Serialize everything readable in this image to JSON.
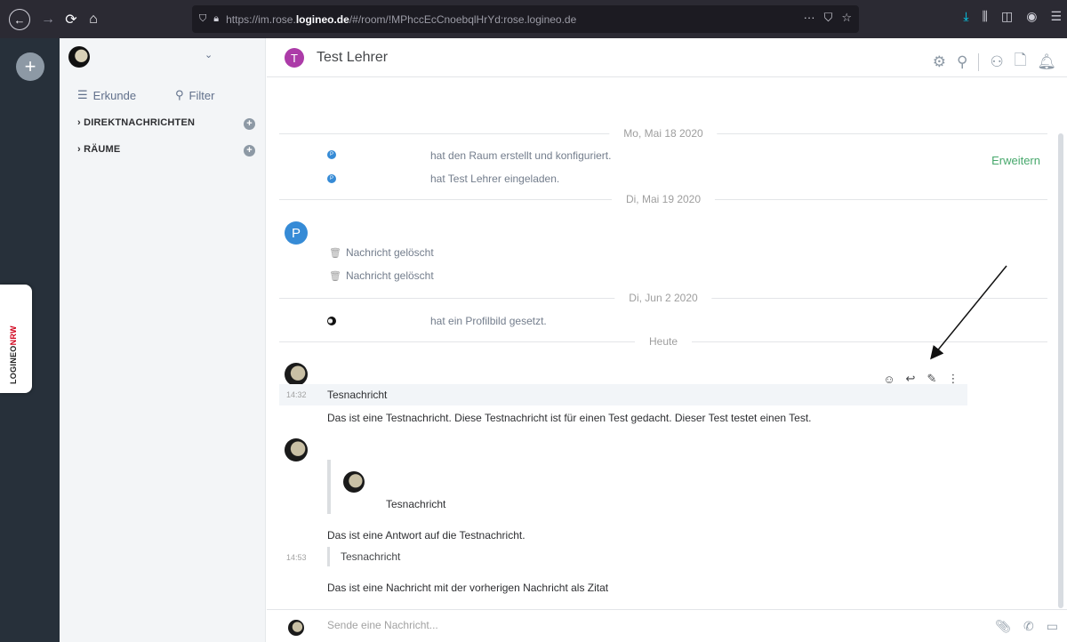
{
  "browser": {
    "url_prefix": "https://im.rose.",
    "url_domain": "logineo.de",
    "url_suffix": "/#/room/!MPhccEcCnoebqlHrYd:rose.logineo.de",
    "icons": [
      "back-icon",
      "forward-icon",
      "reload-icon",
      "home-icon",
      "shield-icon",
      "lock-icon",
      "more-icon",
      "pocket-icon",
      "bookmark-star-icon",
      "download-icon",
      "library-icon",
      "sidebar-icon",
      "account-icon",
      "menu-icon"
    ]
  },
  "logineo": {
    "prefix": "LOGINEO",
    "suffix": "NRW"
  },
  "sidebar": {
    "explore_label": "Erkunde",
    "filter_label": "Filter",
    "sections": [
      {
        "label": "DIREKTNACHRICHTEN"
      },
      {
        "label": "RÄUME"
      }
    ]
  },
  "room": {
    "avatar_letter": "T",
    "title": "Test Lehrer"
  },
  "timeline": {
    "dates": [
      "Mo, Mai 18 2020",
      "Di, Mai 19 2020",
      "Di, Jun 2 2020",
      "Heute"
    ],
    "events": [
      {
        "avatar": "P",
        "text": "hat den Raum erstellt und konfiguriert."
      },
      {
        "avatar": "P",
        "text": "hat Test Lehrer eingeladen."
      },
      {
        "avatar": "",
        "text": "hat ein Profilbild gesetzt."
      }
    ],
    "expand_label": "Erweitern",
    "sender_letter": "P",
    "deleted": [
      "Nachricht gelöscht",
      "Nachricht gelöscht"
    ],
    "messages": [
      {
        "time": "14:32",
        "subject": "Tesnachricht",
        "body": "Das ist eine Testnachricht. Diese Testnachricht ist für einen Test gedacht. Dieser Test testet einen Test."
      }
    ],
    "reply": {
      "quoted_name": "Tesnachricht",
      "body": "Das ist eine Antwort auf die Testnachricht.",
      "time": "14:53",
      "quote_line": "Tesnachricht",
      "final": "Das ist eine Nachricht mit der vorherigen Nachricht als Zitat"
    }
  },
  "composer": {
    "placeholder": "Sende eine Nachricht..."
  }
}
